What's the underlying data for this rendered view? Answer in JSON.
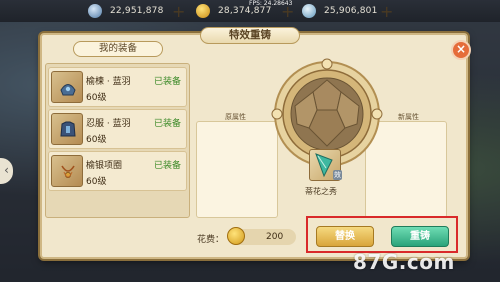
{
  "topbar": {
    "currencies": [
      {
        "icon": "gem-icon",
        "value": "22,951,878",
        "color": "#8fb3d8"
      },
      {
        "icon": "gold-coin-icon",
        "value": "28,374,877",
        "color": "#f0c43a"
      },
      {
        "icon": "silver-coin-icon",
        "value": "25,906,801",
        "color": "#9ec8e6"
      }
    ],
    "plus": "+",
    "fps": "FPS: 24.28643"
  },
  "panel": {
    "title": "特效重铸",
    "close": "×"
  },
  "equipment": {
    "title": "我的装备",
    "items": [
      {
        "name": "榆楝 · 蓝羽",
        "level": "60级",
        "status": "已装备",
        "icon": "helmet-icon"
      },
      {
        "name": "忍服 · 蓝羽",
        "level": "60级",
        "status": "已装备",
        "icon": "armor-icon"
      },
      {
        "name": "榆银项圈",
        "level": "60级",
        "status": "已装备",
        "icon": "necklace-icon"
      }
    ]
  },
  "attributes": {
    "original_label": "原属性",
    "new_label": "新属性"
  },
  "center_item": {
    "name": "蒂花之秀",
    "badge": "效"
  },
  "cost": {
    "label": "花费：",
    "value": "200"
  },
  "buttons": {
    "replace": "替换",
    "recast": "重铸"
  },
  "side_arrow": "‹",
  "watermark": "87G.com"
}
